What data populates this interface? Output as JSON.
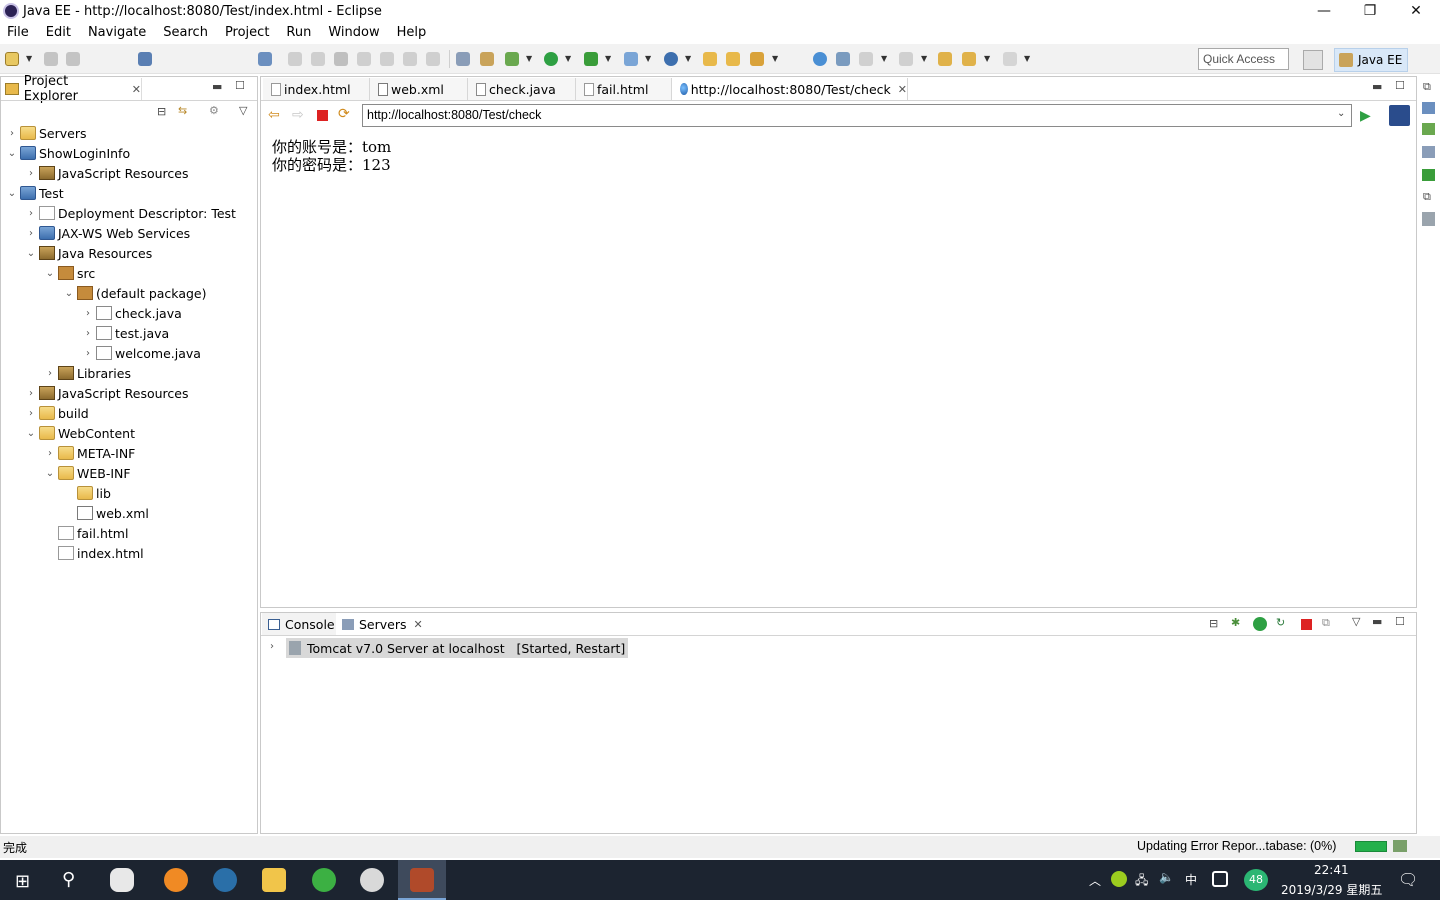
{
  "window": {
    "title": "Java EE - http://localhost:8080/Test/index.html - Eclipse",
    "minimize": "—",
    "restore": "❐",
    "close": "✕"
  },
  "menu": [
    "File",
    "Edit",
    "Navigate",
    "Search",
    "Project",
    "Run",
    "Window",
    "Help"
  ],
  "toolbar": {
    "quick_access_placeholder": "Quick Access",
    "perspective": "Java EE"
  },
  "project_explorer": {
    "title": "Project Explorer",
    "tree": [
      {
        "label": "Servers",
        "twisty": "›",
        "icon": "folder-icon"
      },
      {
        "label": "ShowLoginInfo",
        "twisty": "⌄",
        "icon": "project-icon"
      },
      {
        "label": "JavaScript Resources",
        "twisty": "›",
        "icon": "library-icon"
      },
      {
        "label": "Test",
        "twisty": "⌄",
        "icon": "project-icon"
      },
      {
        "label": "Deployment Descriptor: Test",
        "twisty": "›",
        "icon": "descriptor-icon"
      },
      {
        "label": "JAX-WS Web Services",
        "twisty": "›",
        "icon": "webservice-icon"
      },
      {
        "label": "Java Resources",
        "twisty": "⌄",
        "icon": "java-resources-icon"
      },
      {
        "label": "src",
        "twisty": "⌄",
        "icon": "source-folder-icon"
      },
      {
        "label": "(default package)",
        "twisty": "⌄",
        "icon": "package-icon"
      },
      {
        "label": "check.java",
        "twisty": "›",
        "icon": "java-file-icon"
      },
      {
        "label": "test.java",
        "twisty": "›",
        "icon": "java-file-icon"
      },
      {
        "label": "welcome.java",
        "twisty": "›",
        "icon": "java-file-icon"
      },
      {
        "label": "Libraries",
        "twisty": "›",
        "icon": "library-icon"
      },
      {
        "label": "JavaScript Resources",
        "twisty": "›",
        "icon": "library-icon"
      },
      {
        "label": "build",
        "twisty": "›",
        "icon": "folder-icon"
      },
      {
        "label": "WebContent",
        "twisty": "⌄",
        "icon": "folder-icon"
      },
      {
        "label": "META-INF",
        "twisty": "›",
        "icon": "folder-icon"
      },
      {
        "label": "WEB-INF",
        "twisty": "⌄",
        "icon": "folder-icon"
      },
      {
        "label": "lib",
        "twisty": "",
        "icon": "folder-icon"
      },
      {
        "label": "web.xml",
        "twisty": "",
        "icon": "xml-file-icon"
      },
      {
        "label": "fail.html",
        "twisty": "",
        "icon": "html-file-icon"
      },
      {
        "label": "index.html",
        "twisty": "",
        "icon": "html-file-icon"
      }
    ]
  },
  "editor": {
    "tabs": [
      "index.html",
      "web.xml",
      "check.java",
      "fail.html",
      "http://localhost:8080/Test/check"
    ],
    "url": "http://localhost:8080/Test/check",
    "content_lines": [
      "你的账号是：tom",
      "你的密码是：123"
    ]
  },
  "bottom_panel": {
    "tabs": [
      "Console",
      "Servers"
    ],
    "server": "Tomcat v7.0 Server at localhost   [Started, Restart]"
  },
  "status": {
    "left": "完成",
    "right": "Updating Error Repor...tabase: (0%)",
    "progress": 0
  },
  "taskbar": {
    "time": "22:41",
    "date": "2019/3/29 星期五",
    "ime": "中",
    "badge": "48"
  }
}
